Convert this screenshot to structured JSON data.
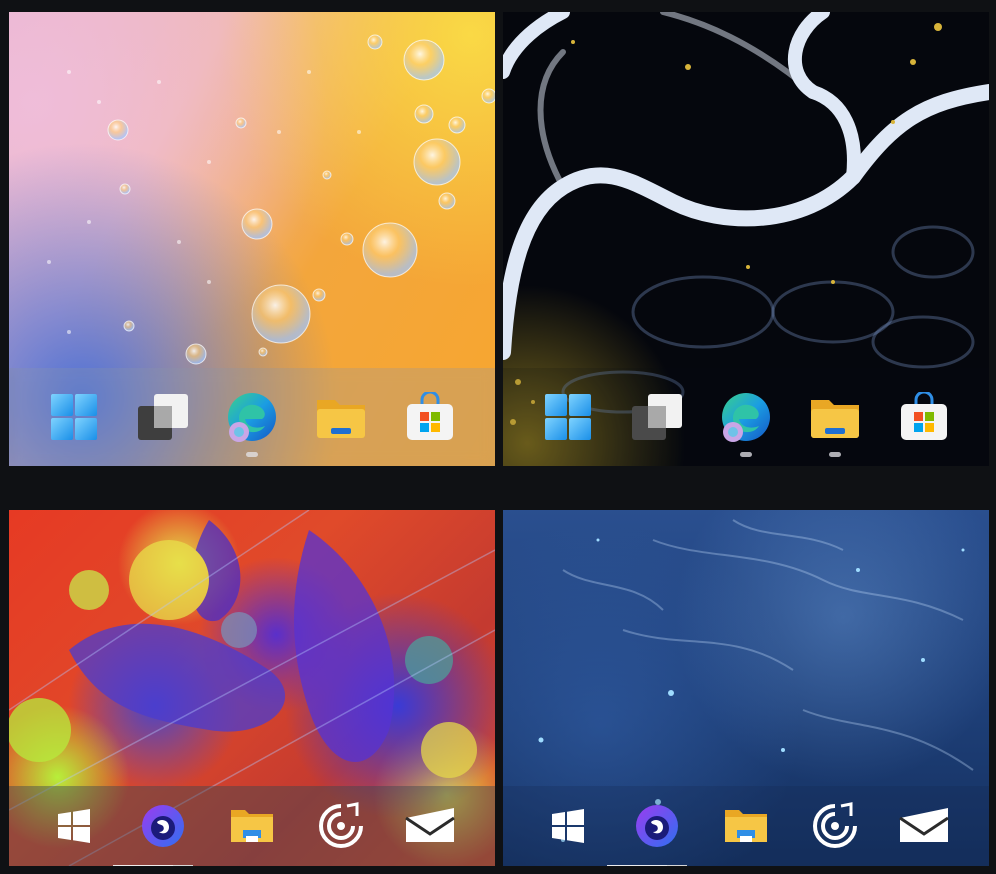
{
  "tiles": [
    {
      "wallpaper": "orange-pink-water-bubbles",
      "taskbar_style": "windows-11-acrylic",
      "apps": [
        {
          "icon": "windows-11-start-icon",
          "running": false
        },
        {
          "icon": "task-view-icon",
          "running": false
        },
        {
          "icon": "edge-icon",
          "running": true
        },
        {
          "icon": "file-explorer-icon",
          "running": false
        },
        {
          "icon": "microsoft-store-icon",
          "running": false
        }
      ]
    },
    {
      "wallpaper": "dark-fluid-paint",
      "taskbar_style": "windows-11-transparent",
      "apps": [
        {
          "icon": "windows-11-start-icon",
          "running": false
        },
        {
          "icon": "task-view-icon",
          "running": false
        },
        {
          "icon": "edge-icon",
          "running": true
        },
        {
          "icon": "file-explorer-icon",
          "running": true
        },
        {
          "icon": "microsoft-store-icon",
          "running": false
        }
      ]
    },
    {
      "wallpaper": "colorful-abstract-paint",
      "taskbar_style": "windows-10",
      "apps": [
        {
          "icon": "windows-10-start-icon",
          "running": false
        },
        {
          "icon": "firefox-icon",
          "running": true
        },
        {
          "icon": "file-explorer-icon",
          "running": false
        },
        {
          "icon": "groove-music-icon",
          "running": false
        },
        {
          "icon": "mail-icon",
          "running": false
        }
      ]
    },
    {
      "wallpaper": "blue-space-nebula",
      "taskbar_style": "windows-10",
      "apps": [
        {
          "icon": "windows-10-start-icon",
          "running": false
        },
        {
          "icon": "firefox-icon",
          "running": true
        },
        {
          "icon": "file-explorer-icon",
          "running": false
        },
        {
          "icon": "groove-music-icon",
          "running": false
        },
        {
          "icon": "mail-icon",
          "running": false
        }
      ]
    }
  ],
  "colors": {
    "background": "#0f1114",
    "win11_blue": "#3aa0f0",
    "edge_teal": "#2fc3a7",
    "folder_yellow": "#f6c645",
    "firefox_purple": "#7a3df0"
  }
}
